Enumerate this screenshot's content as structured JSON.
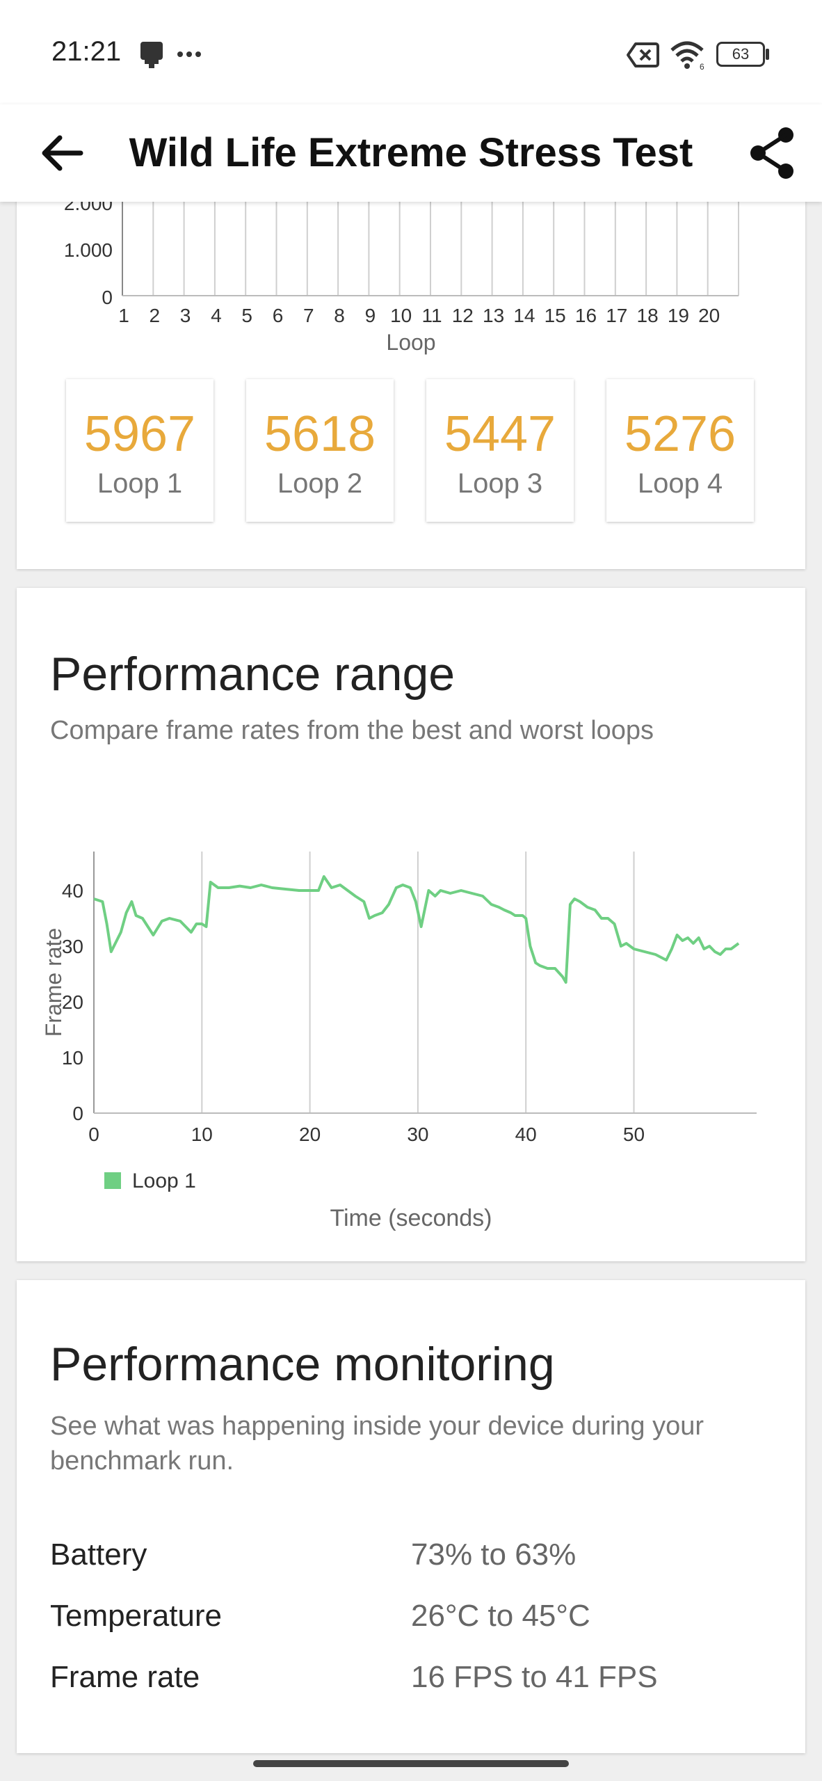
{
  "status_bar": {
    "time": "21:21",
    "icons": [
      "notification-icon",
      "more-dots-icon",
      "no-sim-icon",
      "wifi-icon",
      "battery-icon"
    ],
    "battery_level": "63"
  },
  "app_bar": {
    "title": "Wild Life Extreme Stress Test",
    "back_icon": "back-arrow-icon",
    "share_icon": "share-icon"
  },
  "loops_section": {
    "chart_data": {
      "type": "bar",
      "xlabel": "Loop",
      "x_ticks": [
        "1",
        "2",
        "3",
        "4",
        "5",
        "6",
        "7",
        "8",
        "9",
        "10",
        "11",
        "12",
        "13",
        "14",
        "15",
        "16",
        "17",
        "18",
        "19",
        "20"
      ],
      "y_ticks_visible": [
        "2.000",
        "1.000",
        "0"
      ]
    },
    "scores": [
      {
        "value": "5967",
        "label": "Loop 1"
      },
      {
        "value": "5618",
        "label": "Loop 2"
      },
      {
        "value": "5447",
        "label": "Loop 3"
      },
      {
        "value": "5276",
        "label": "Loop 4"
      }
    ],
    "score_color": "#e8a93b"
  },
  "range_section": {
    "title": "Performance range",
    "subtitle": "Compare frame rates from the best and worst loops"
  },
  "chart_data": {
    "type": "line",
    "xlabel": "Time (seconds)",
    "ylabel": "Frame rate",
    "xlim": [
      0,
      60
    ],
    "ylim": [
      0,
      47
    ],
    "x_ticks": [
      0,
      10,
      20,
      30,
      40,
      50
    ],
    "y_ticks": [
      0,
      10,
      20,
      30,
      40
    ],
    "legend_position": "bottom-left",
    "series": [
      {
        "name": "Loop 1",
        "color": "#6fcf83",
        "x": [
          0,
          0.8,
          1.2,
          1.6,
          2.5,
          3.0,
          3.5,
          3.9,
          4.5,
          5.5,
          6.3,
          7.0,
          8.0,
          8.5,
          9.0,
          9.5,
          10.0,
          10.4,
          10.8,
          11.5,
          12.5,
          13.5,
          14.5,
          15.5,
          16.5,
          17.5,
          19.0,
          20.0,
          20.8,
          21.3,
          22.0,
          22.8,
          23.5,
          24.2,
          25.0,
          25.5,
          26.0,
          26.7,
          27.3,
          28.0,
          28.6,
          29.3,
          29.8,
          30.3,
          31.0,
          31.6,
          32.1,
          33.0,
          34.0,
          35.0,
          36.0,
          36.8,
          37.5,
          38.0,
          38.6,
          39.0,
          39.7,
          40.0,
          40.4,
          40.9,
          41.3,
          42.0,
          42.7,
          43.4,
          43.7,
          44.1,
          44.5,
          45.0,
          45.7,
          46.4,
          47.0,
          47.6,
          48.2,
          48.8,
          49.3,
          50.0,
          51.0,
          52.0,
          53.0,
          53.5,
          54.0,
          54.5,
          55.0,
          55.5,
          56.0,
          56.5,
          57.0,
          57.5,
          58.0,
          58.5,
          59.0,
          59.7
        ],
        "y": [
          38.5,
          38.0,
          34.0,
          29.0,
          32.5,
          36.0,
          38.0,
          35.5,
          35.0,
          32.0,
          34.5,
          35.0,
          34.5,
          33.5,
          32.5,
          34.0,
          34.0,
          33.5,
          41.5,
          40.5,
          40.5,
          40.8,
          40.5,
          41.0,
          40.5,
          40.3,
          40.0,
          40.0,
          40.0,
          42.5,
          40.5,
          41.0,
          40.0,
          39.0,
          38.0,
          35.0,
          35.5,
          36.0,
          37.5,
          40.5,
          41.0,
          40.5,
          38.0,
          33.5,
          40.0,
          39.0,
          40.0,
          39.5,
          40.0,
          39.5,
          39.0,
          37.5,
          37.0,
          36.5,
          36.0,
          35.5,
          35.5,
          35.0,
          30.0,
          27.0,
          26.5,
          26.0,
          26.0,
          24.5,
          23.5,
          37.5,
          38.5,
          38.0,
          37.0,
          36.5,
          35.0,
          35.0,
          34.0,
          30.0,
          30.5,
          29.5,
          29.0,
          28.5,
          27.5,
          29.5,
          32.0,
          31.0,
          31.5,
          30.5,
          31.5,
          29.5,
          30.0,
          29.0,
          28.5,
          29.5,
          29.5,
          30.5
        ]
      }
    ]
  },
  "monitor_section": {
    "title": "Performance monitoring",
    "subtitle": "See what was happening inside your device during your benchmark run.",
    "rows": [
      {
        "label": "Battery",
        "value": "73% to 63%"
      },
      {
        "label": "Temperature",
        "value": "26°C to 45°C"
      },
      {
        "label": "Frame rate",
        "value": "16 FPS to 41 FPS"
      }
    ]
  }
}
